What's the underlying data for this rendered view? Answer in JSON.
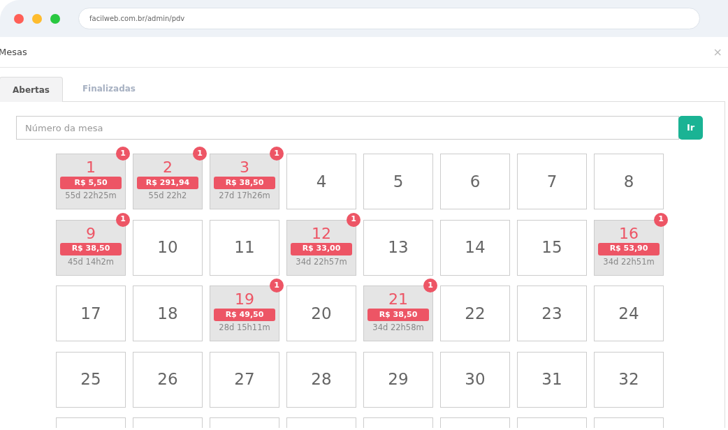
{
  "browser": {
    "address": "facilweb.com.br/admin/pdv"
  },
  "window": {
    "title": "Mesas",
    "close": "×"
  },
  "tabs": [
    {
      "label": "Abertas",
      "selected": true
    },
    {
      "label": "Finalizadas",
      "selected": false
    }
  ],
  "search": {
    "placeholder": "Número da mesa",
    "button": "Ir"
  },
  "tables": [
    {
      "number": "1",
      "occupied": true,
      "badge": "1",
      "total": "R$ 5,50",
      "elapsed": "55d 22h25m"
    },
    {
      "number": "2",
      "occupied": true,
      "badge": "1",
      "total": "R$ 291,94",
      "elapsed": "55d 22h2"
    },
    {
      "number": "3",
      "occupied": true,
      "badge": "1",
      "total": "R$ 38,50",
      "elapsed": "27d 17h26m"
    },
    {
      "number": "4",
      "occupied": false
    },
    {
      "number": "5",
      "occupied": false
    },
    {
      "number": "6",
      "occupied": false
    },
    {
      "number": "7",
      "occupied": false
    },
    {
      "number": "8",
      "occupied": false
    },
    {
      "number": "9",
      "occupied": true,
      "badge": "1",
      "total": "R$ 38,50",
      "elapsed": "45d 14h2m"
    },
    {
      "number": "10",
      "occupied": false
    },
    {
      "number": "11",
      "occupied": false
    },
    {
      "number": "12",
      "occupied": true,
      "badge": "1",
      "total": "R$ 33,00",
      "elapsed": "34d 22h57m"
    },
    {
      "number": "13",
      "occupied": false
    },
    {
      "number": "14",
      "occupied": false
    },
    {
      "number": "15",
      "occupied": false
    },
    {
      "number": "16",
      "occupied": true,
      "badge": "1",
      "total": "R$ 53,90",
      "elapsed": "34d 22h51m"
    },
    {
      "number": "17",
      "occupied": false
    },
    {
      "number": "18",
      "occupied": false
    },
    {
      "number": "19",
      "occupied": true,
      "badge": "1",
      "total": "R$ 49,50",
      "elapsed": "28d 15h11m"
    },
    {
      "number": "20",
      "occupied": false
    },
    {
      "number": "21",
      "occupied": true,
      "badge": "1",
      "total": "R$ 38,50",
      "elapsed": "34d 22h58m"
    },
    {
      "number": "22",
      "occupied": false
    },
    {
      "number": "23",
      "occupied": false
    },
    {
      "number": "24",
      "occupied": false
    },
    {
      "number": "25",
      "occupied": false
    },
    {
      "number": "26",
      "occupied": false
    },
    {
      "number": "27",
      "occupied": false
    },
    {
      "number": "28",
      "occupied": false
    },
    {
      "number": "29",
      "occupied": false
    },
    {
      "number": "30",
      "occupied": false
    },
    {
      "number": "31",
      "occupied": false
    },
    {
      "number": "32",
      "occupied": false
    },
    {
      "occupied": false
    },
    {
      "occupied": false
    },
    {
      "occupied": false
    },
    {
      "occupied": false
    },
    {
      "occupied": false
    },
    {
      "occupied": false
    },
    {
      "occupied": false
    },
    {
      "occupied": false
    }
  ]
}
